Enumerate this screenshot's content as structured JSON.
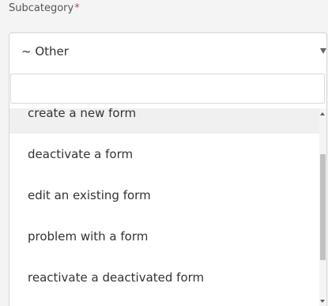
{
  "field": {
    "label": "Subcategory",
    "required_marker": "*",
    "selected_value": "~ Other"
  },
  "search": {
    "value": "",
    "placeholder": ""
  },
  "options": [
    {
      "label": "create a new form",
      "highlighted": true
    },
    {
      "label": "deactivate a form",
      "highlighted": false
    },
    {
      "label": "edit an existing form",
      "highlighted": false
    },
    {
      "label": "problem with a form",
      "highlighted": false
    },
    {
      "label": "reactivate a deactivated form",
      "highlighted": false
    }
  ],
  "scrollbar": {
    "thumb_fraction": 0.54,
    "scroll_position": 0.39
  },
  "colors": {
    "required": "#e03a3a",
    "highlight": "#f0f0f0",
    "text": "#333333"
  },
  "icons": {
    "caret": "caret-down-icon",
    "scroll_up": "scroll-up-icon",
    "scroll_down": "scroll-down-icon"
  }
}
